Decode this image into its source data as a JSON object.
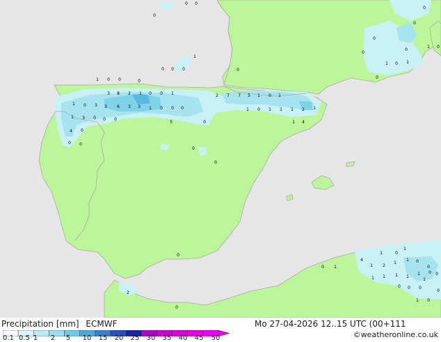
{
  "map": {
    "colors": {
      "sea": "#e6e6e6",
      "land": "#bdf59a",
      "coast": "#a9a9a9",
      "precip_light": "#c8f0f5",
      "precip_mid": "#a6e3ef",
      "precip_heavy": "#7fd3e8",
      "precip_dark": "#5ab8e0"
    },
    "value_labels": [
      "0",
      "0",
      "0",
      "0",
      "0",
      "1",
      "0",
      "0",
      "0",
      "0",
      "1",
      "0",
      "0",
      "0",
      "0",
      "0",
      "0",
      "1",
      "0",
      "0",
      "1",
      "0",
      "1",
      "3",
      "8",
      "2",
      "1",
      "0",
      "0",
      "1",
      "2",
      "7",
      "7",
      "5",
      "1",
      "0",
      "1",
      "1",
      "0",
      "3",
      "3",
      "6",
      "3",
      "3",
      "1",
      "0",
      "0",
      "0",
      "1",
      "0",
      "1",
      "1",
      "1",
      "2",
      "1",
      "1",
      "3",
      "0",
      "0",
      "0",
      "5",
      "0",
      "1",
      "4",
      "4",
      "0",
      "0",
      "0",
      "0",
      "0",
      "0",
      "0",
      "1",
      "1",
      "2",
      "1",
      "1",
      "0",
      "0",
      "1",
      "1",
      "1",
      "1",
      "1",
      "0",
      "0",
      "0",
      "2",
      "0",
      "1",
      "0",
      "0",
      "0",
      "1",
      "4",
      "0",
      "1",
      "1",
      "0"
    ]
  },
  "footer": {
    "title": "Precipitation [mm]",
    "model": "ECMWF",
    "datetime": "Mo 27-04-2026 12..15 UTC (00+111",
    "credit": "©weatheronline.co.uk",
    "legend": {
      "labels": [
        "0.1",
        "0.5",
        "1",
        "2",
        "5",
        "10",
        "15",
        "20",
        "25",
        "30",
        "35",
        "40",
        "45",
        "50"
      ],
      "colors": [
        "#f4fbff",
        "#d8f4f9",
        "#b8ecf4",
        "#98e0ef",
        "#6fc9e8",
        "#4aa9dc",
        "#3a7fd0",
        "#2a4fc0",
        "#1b22a8",
        "#b000c8",
        "#c800d8",
        "#d800e0",
        "#e400e8",
        "#ee00f0"
      ]
    }
  }
}
